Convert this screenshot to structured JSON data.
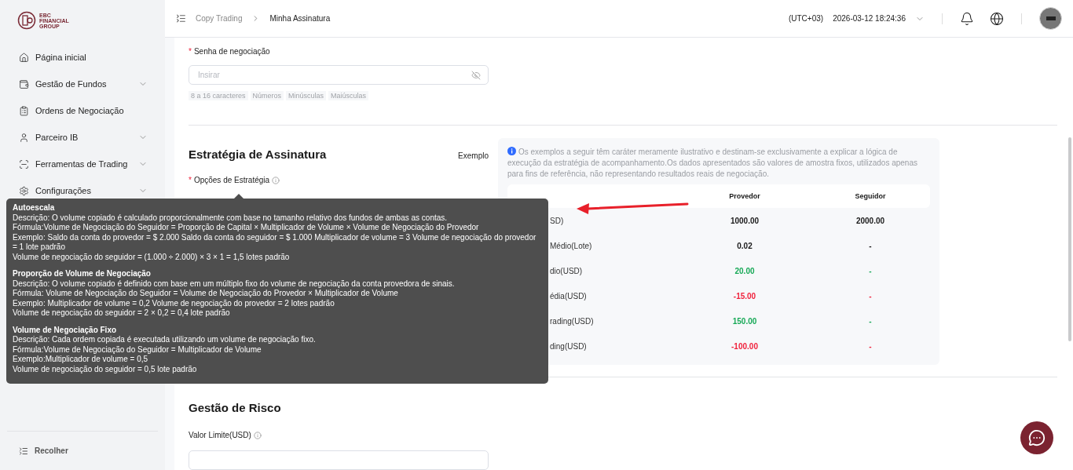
{
  "logo": {
    "lines": [
      "EBC",
      "FINANCIAL",
      "GROUP"
    ]
  },
  "sidebar": {
    "items": [
      {
        "label": "Página inicial",
        "has_submenu": false
      },
      {
        "label": "Gestão de Fundos",
        "has_submenu": true
      },
      {
        "label": "Ordens de Negociação",
        "has_submenu": false
      },
      {
        "label": "Parceiro IB",
        "has_submenu": true
      },
      {
        "label": "Ferramentas de Trading",
        "has_submenu": true
      },
      {
        "label": "Configurações",
        "has_submenu": true
      }
    ],
    "collapse": "Recolher"
  },
  "breadcrumb": [
    {
      "label": "Copy Trading",
      "selected": false
    },
    {
      "label": "Minha Assinatura",
      "selected": true
    }
  ],
  "header": {
    "timezone": "(UTC+03)",
    "datetime": "2026-03-12 18:24:36"
  },
  "password": {
    "label": "Senha de negociação",
    "required_mark": "*",
    "placeholder": "Insirar",
    "hints": [
      "8 a 16 caracteres",
      "Números",
      "Minúsculas",
      "Maiúsculas"
    ]
  },
  "strategy": {
    "title": "Estratégia de Assinatura",
    "example_link": "Exemplo",
    "options_label": "Opções de Estratégia",
    "required_mark": "*"
  },
  "example": {
    "note": "Os exemplos a seguir têm caráter meramente ilustrativo e destinam-se exclusivamente a explicar a lógica de execução da estratégia de acompanhamento.Os dados apresentados são valores de amostra fixos, utilizados apenas para fins de referência, não representando resultados reais de negociação.",
    "columns": [
      "Provedor",
      "Seguidor"
    ],
    "rows": [
      {
        "label": "SD)",
        "provider": {
          "text": "1000.00",
          "color": "#1a1a1a"
        },
        "follower": "2000.00"
      },
      {
        "label": "Médio(Lote)",
        "provider": {
          "text": "0.02",
          "color": "#1a1a1a"
        },
        "follower": "-"
      },
      {
        "label": "dio(USD)",
        "provider": {
          "text": "20.00",
          "color": "#18a957"
        },
        "follower": "-"
      },
      {
        "label": "édia(USD)",
        "provider": {
          "text": "-15.00",
          "color": "#f0223c"
        },
        "follower": "-"
      },
      {
        "label": "rading(USD)",
        "provider": {
          "text": "150.00",
          "color": "#18a957"
        },
        "follower": "-"
      },
      {
        "label": "ding(USD)",
        "provider": {
          "text": "-100.00",
          "color": "#f0223c"
        },
        "follower": "-"
      }
    ]
  },
  "tooltip": {
    "sections": [
      {
        "title": "Autoescala",
        "lines": [
          "Descrição: O volume copiado é calculado proporcionalmente com base no tamanho relativo dos fundos de ambas as contas.",
          "Fórmula:Volume de Negociação do Seguidor = Proporção de Capital × Multiplicador de Volume × Volume de Negociação do Provedor",
          "Exemplo: Saldo da conta do provedor = $ 2.000 Saldo da conta do seguidor = $ 1.000 Multiplicador de volume = 3 Volume de negociação do provedor = 1 lote padrão",
          "Volume de negociação do seguidor = (1.000 ÷ 2.000) × 3 × 1 = 1,5 lotes padrão"
        ]
      },
      {
        "title": "Proporção de Volume de Negociação",
        "lines": [
          "Descrição: O volume copiado é definido com base em um múltiplo fixo do volume de negociação da conta provedora de sinais.",
          "Fórmula: Volume de Negociação do Seguidor = Volume de Negociação do Provedor × Multiplicador de Volume",
          "Exemplo: Multiplicador de volume = 0,2 Volume de negociação do provedor = 2 lotes padrão",
          "Volume de negociação do seguidor = 2 × 0,2 = 0,4 lote padrão"
        ]
      },
      {
        "title": "Volume de Negociação Fixo",
        "lines": [
          "Descrição: Cada ordem copiada é executada utilizando um volume de negociação fixo.",
          "Fórmula:Volume de Negociação do Seguidor = Multiplicador de Volume",
          "Exemplo:Multiplicador de volume = 0,5",
          "Volume de negociação do seguidor = 0,5 lote padrão"
        ]
      }
    ]
  },
  "risk": {
    "title": "Gestão de Risco",
    "limit_label": "Valor Limite(USD)"
  }
}
